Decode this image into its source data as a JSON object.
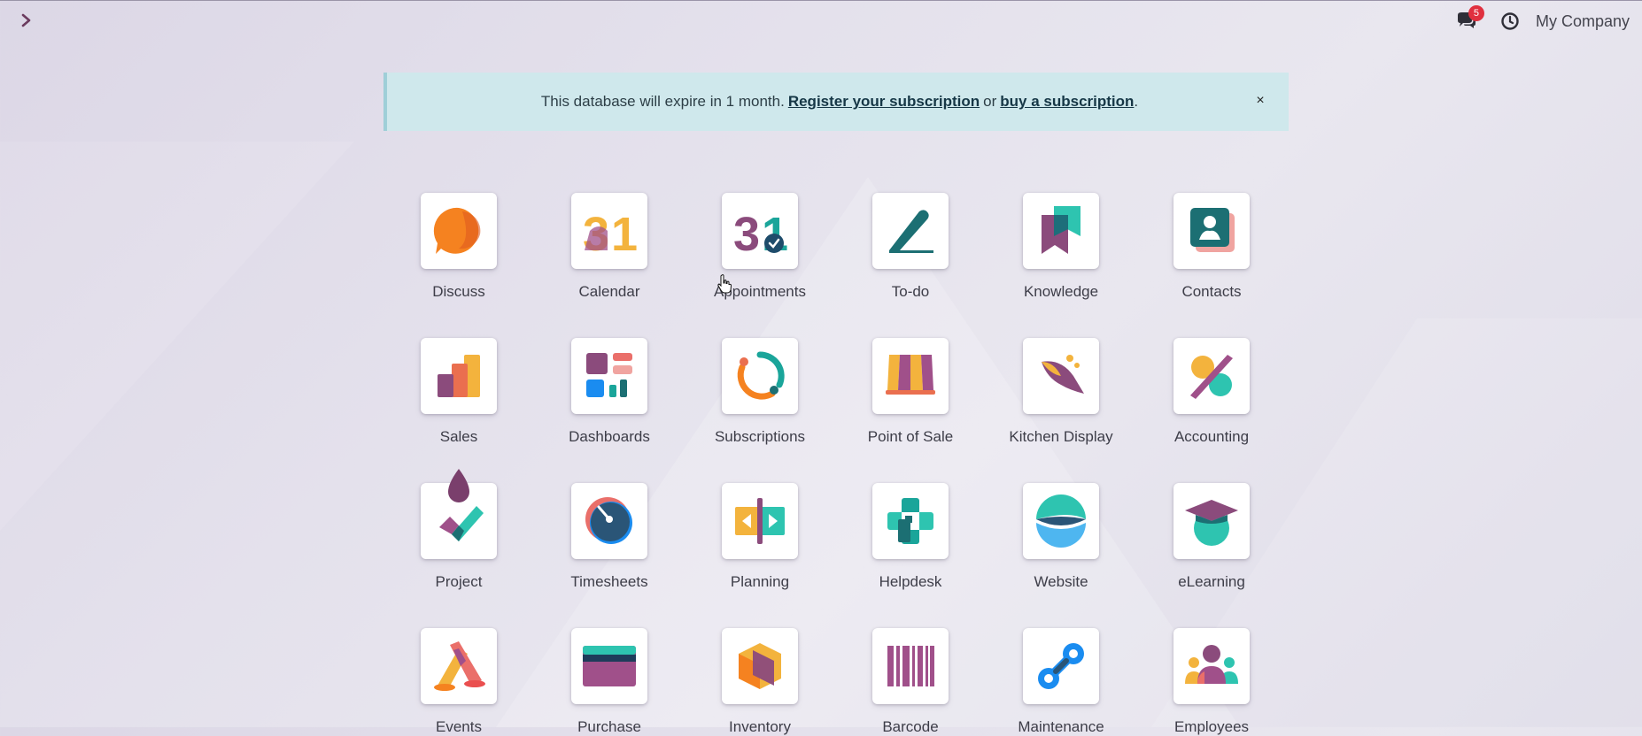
{
  "topbar": {
    "notification_count": "5",
    "company_name": "My Company"
  },
  "banner": {
    "text_before": "This database will expire in 1 month.",
    "register_link": "Register your subscription",
    "text_middle": "or",
    "buy_link": "buy a subscription",
    "text_after": ".",
    "close_label": "×"
  },
  "apps": [
    {
      "label": "Discuss",
      "icon": "discuss-icon"
    },
    {
      "label": "Calendar",
      "icon": "calendar-icon"
    },
    {
      "label": "Appointments",
      "icon": "appointments-icon"
    },
    {
      "label": "To-do",
      "icon": "todo-icon"
    },
    {
      "label": "Knowledge",
      "icon": "knowledge-icon"
    },
    {
      "label": "Contacts",
      "icon": "contacts-icon"
    },
    {
      "label": "Sales",
      "icon": "sales-icon"
    },
    {
      "label": "Dashboards",
      "icon": "dashboards-icon"
    },
    {
      "label": "Subscriptions",
      "icon": "subscriptions-icon"
    },
    {
      "label": "Point of Sale",
      "icon": "point-of-sale-icon"
    },
    {
      "label": "Kitchen Display",
      "icon": "kitchen-display-icon"
    },
    {
      "label": "Accounting",
      "icon": "accounting-icon"
    },
    {
      "label": "Project",
      "icon": "project-icon"
    },
    {
      "label": "Timesheets",
      "icon": "timesheets-icon"
    },
    {
      "label": "Planning",
      "icon": "planning-icon"
    },
    {
      "label": "Helpdesk",
      "icon": "helpdesk-icon"
    },
    {
      "label": "Website",
      "icon": "website-icon"
    },
    {
      "label": "eLearning",
      "icon": "elearning-icon"
    },
    {
      "label": "Events",
      "icon": "events-icon"
    },
    {
      "label": "Purchase",
      "icon": "purchase-icon"
    },
    {
      "label": "Inventory",
      "icon": "inventory-icon"
    },
    {
      "label": "Barcode",
      "icon": "barcode-icon"
    },
    {
      "label": "Maintenance",
      "icon": "maintenance-icon"
    },
    {
      "label": "Employees",
      "icon": "employees-icon"
    }
  ]
}
